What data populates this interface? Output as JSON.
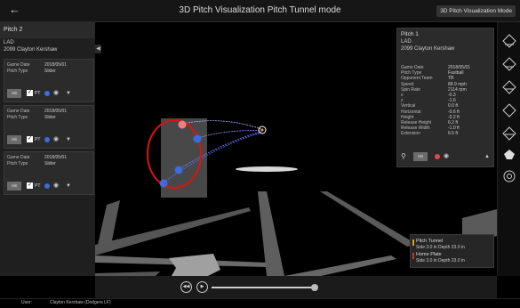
{
  "header": {
    "back_icon": "back-arrow-icon",
    "title": "3D Pitch Visualization Pitch Tunnel mode",
    "right_button": "3D Pitch Visualization Mode"
  },
  "left_panel": {
    "header": "Pitch 2",
    "sub_code": "LAD",
    "sub_name": "2099 Clayton Kershaw",
    "cards": [
      {
        "date_label": "Game Date",
        "date_value": "2018/05/01",
        "type_label": "Pitch Type",
        "type_value": "Slider",
        "btn": "Hit",
        "pt": "PT"
      },
      {
        "date_label": "Game Date",
        "date_value": "2018/05/01",
        "type_label": "Pitch Type",
        "type_value": "Slider",
        "btn": "Hit",
        "pt": "PT"
      },
      {
        "date_label": "Game Date",
        "date_value": "2018/05/01",
        "type_label": "Pitch Type",
        "type_value": "Slider",
        "btn": "Hit",
        "pt": "PT"
      }
    ]
  },
  "right_panel": {
    "title": "Pitch 1",
    "code": "LAD",
    "name": "2099 Clayton Kershaw",
    "rows": [
      {
        "label": "Game Date",
        "value": "2018/05/01"
      },
      {
        "label": "Pitch Type",
        "value": "Fastball"
      },
      {
        "label": "Opponent Team",
        "value": "TB"
      },
      {
        "label": "Speed",
        "value": "88.9 mph"
      },
      {
        "label": "Spin Rate",
        "value": "2114 rpm"
      },
      {
        "label": "x",
        "value": "-0.3"
      },
      {
        "label": "z",
        "value": "-1.6"
      },
      {
        "label": "Vertical",
        "value": "0.0 ft"
      },
      {
        "label": "Horizontal",
        "value": "-0.6 ft"
      },
      {
        "label": "Height",
        "value": "-0.2 ft"
      },
      {
        "label": "Release Height",
        "value": "6.2 ft"
      },
      {
        "label": "Release Width",
        "value": "-1.0 ft"
      },
      {
        "label": "Extension",
        "value": "6.5 ft"
      }
    ],
    "btn": "Hit"
  },
  "legend": {
    "item1_title": "Pitch Tunnel",
    "item1_sub": "Side 3.0 in  Depth 23.0 in",
    "item2_title": "Home Plate",
    "item2_sub": "Side 3.0 in  Depth 23.0 in",
    "color1": "#e0a020",
    "color2": "#d03030"
  },
  "status": {
    "label": "User:",
    "value": "Clayton Kershaw (Dodgers LF)"
  },
  "colors": {
    "ball_blue": "#3b6bdc",
    "ball_pink": "#f08080",
    "ring_red": "#e01010"
  }
}
